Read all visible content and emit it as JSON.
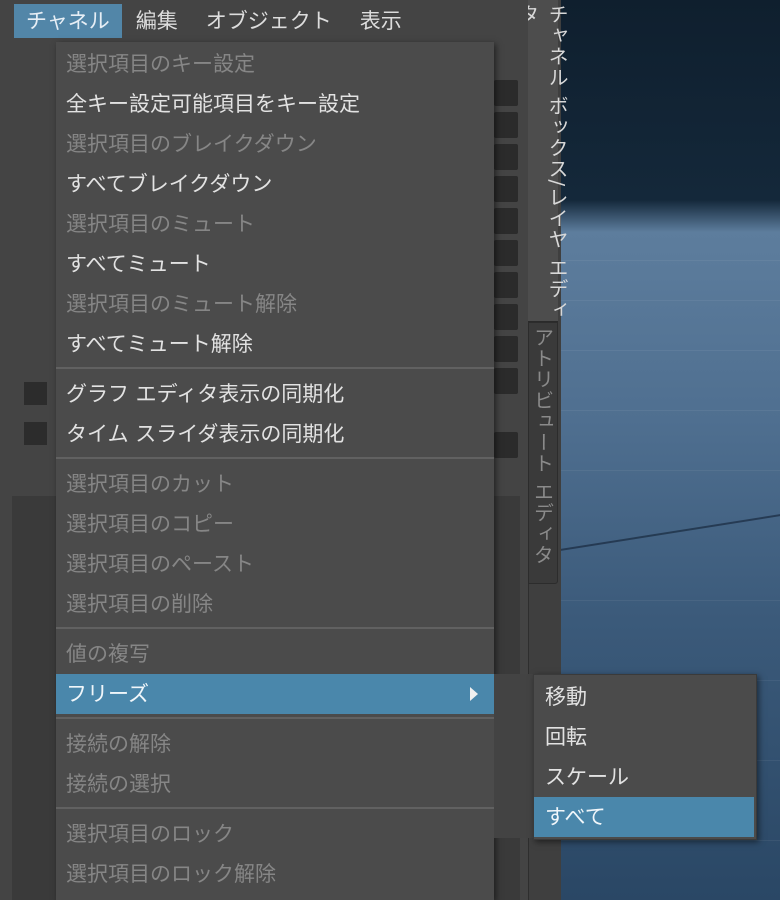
{
  "menubar": {
    "items": [
      "チャネル",
      "編集",
      "オブジェクト",
      "表示"
    ],
    "active_index": 0
  },
  "side_tabs": {
    "active": "チャネル ボックス/レイヤ エディタ",
    "inactive": "アトリビュート エディタ"
  },
  "menu": {
    "items": [
      {
        "label": "選択項目のキー設定",
        "enabled": false
      },
      {
        "label": "全キー設定可能項目をキー設定",
        "enabled": true
      },
      {
        "label": "選択項目のブレイクダウン",
        "enabled": false
      },
      {
        "label": "すべてブレイクダウン",
        "enabled": true
      },
      {
        "label": "選択項目のミュート",
        "enabled": false
      },
      {
        "label": "すべてミュート",
        "enabled": true
      },
      {
        "label": "選択項目のミュート解除",
        "enabled": false
      },
      {
        "label": "すべてミュート解除",
        "enabled": true
      },
      {
        "label": "グラフ エディタ表示の同期化",
        "enabled": true,
        "checkbox": true
      },
      {
        "label": "タイム スライダ表示の同期化",
        "enabled": true,
        "checkbox": true
      },
      {
        "label": "選択項目のカット",
        "enabled": false
      },
      {
        "label": "選択項目のコピー",
        "enabled": false
      },
      {
        "label": "選択項目のペースト",
        "enabled": false
      },
      {
        "label": "選択項目の削除",
        "enabled": false
      },
      {
        "label": "値の複写",
        "enabled": false
      },
      {
        "label": "フリーズ",
        "enabled": true,
        "highlighted": true,
        "submenu": true
      },
      {
        "label": "接続の解除",
        "enabled": false
      },
      {
        "label": "接続の選択",
        "enabled": false
      },
      {
        "label": "選択項目のロック",
        "enabled": false
      },
      {
        "label": "選択項目のロック解除",
        "enabled": false
      }
    ]
  },
  "submenu": {
    "items": [
      "移動",
      "回転",
      "スケール",
      "すべて"
    ],
    "highlighted_index": 3
  },
  "colors": {
    "highlight": "#4a87ab",
    "menu_bg": "#4b4b4b",
    "disabled_text": "#868686"
  }
}
